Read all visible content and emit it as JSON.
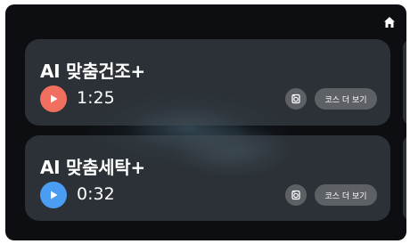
{
  "colors": {
    "play_course_1": "#f16f5f",
    "play_course_2": "#4a9df2",
    "card_bg": "#464e56",
    "button_bg": "#5d6166"
  },
  "header": {
    "home_icon": "home-icon"
  },
  "courses": [
    {
      "title": "AI 맞춤건조+",
      "time": "1:25",
      "more_label": "코스 더 보기",
      "play_icon": "play-icon",
      "option_icon": "dryer-option-icon"
    },
    {
      "title": "AI 맞춤세탁+",
      "time": "0:32",
      "more_label": "코스 더 보기",
      "play_icon": "play-icon",
      "option_icon": "washer-option-icon"
    }
  ]
}
